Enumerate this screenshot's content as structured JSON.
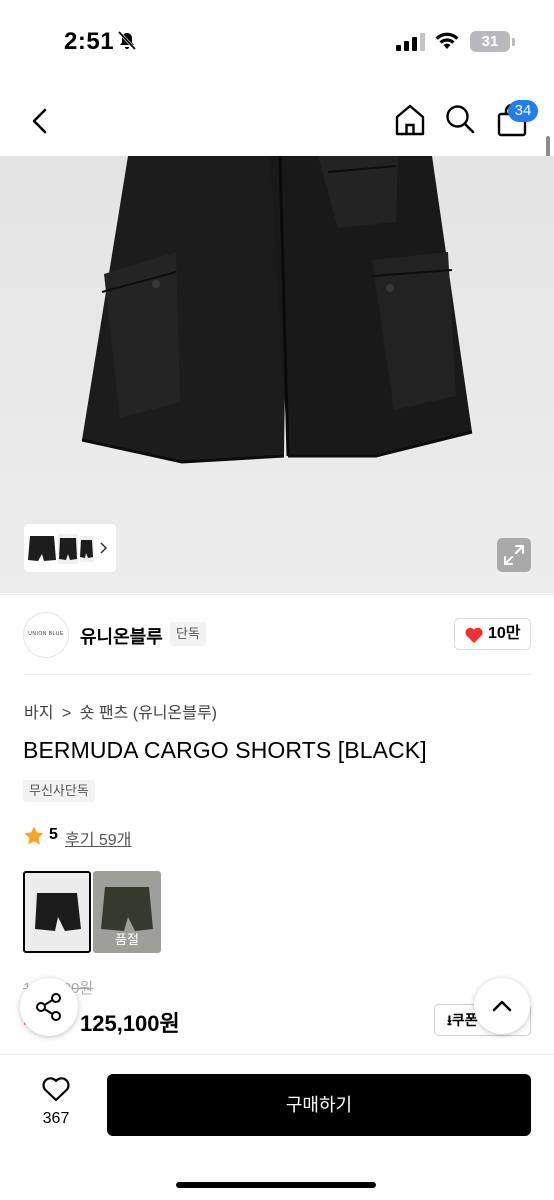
{
  "status_bar": {
    "time": "2:51",
    "battery": "31"
  },
  "nav": {
    "cart_badge": "34"
  },
  "product_image": {
    "thumbnails_count": 3
  },
  "brand": {
    "logo_text": "UNION BLUE",
    "name": "유니온블루",
    "tag": "단독",
    "likes": "10만"
  },
  "breadcrumb": {
    "category": "바지",
    "separator": ">",
    "subcategory": "숏 팬츠 (유니온블루)"
  },
  "product": {
    "title": "BERMUDA CARGO SHORTS [BLACK]",
    "exclusive_badge": "무신사단독",
    "rating": "5",
    "reviews": "후기 59개"
  },
  "options": [
    {
      "name": "black",
      "sold_out": false
    },
    {
      "name": "khaki",
      "sold_out": true,
      "label": "품절"
    }
  ],
  "price": {
    "original": "1■■,■00원",
    "discount": "■■",
    "final": "125,100원",
    "coupon_label": "쿠폰"
  },
  "bottom": {
    "wish_count": "367",
    "buy_label": "구매하기"
  },
  "colors": {
    "accent": "#1f7ef5",
    "heart": "#ff2d2d",
    "star": "#f5a623"
  }
}
